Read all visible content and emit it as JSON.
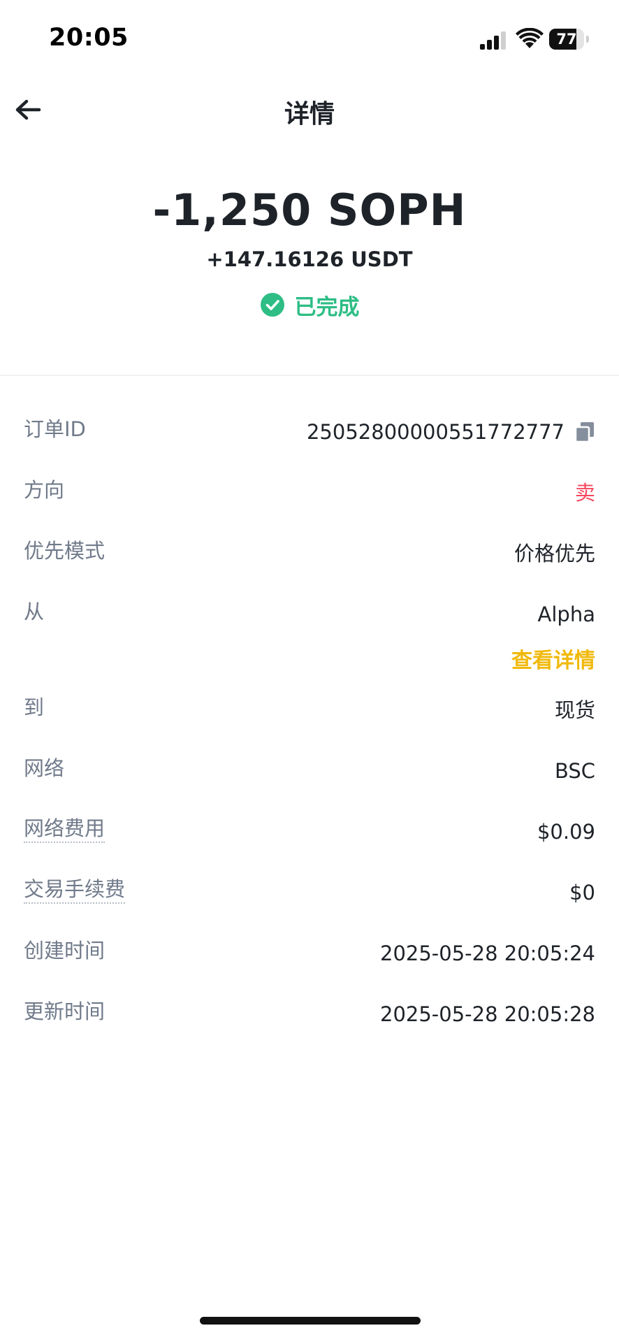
{
  "status_bar": {
    "time": "20:05",
    "battery_level": "77",
    "battery_fraction": 0.77
  },
  "header": {
    "title": "详情"
  },
  "summary": {
    "amount": "-1,250 SOPH",
    "received": "+147.16126 USDT",
    "status": "已完成",
    "status_color": "#2ebd85"
  },
  "details": {
    "order_id": {
      "label": "订单ID",
      "value": "25052800000551772777"
    },
    "direction": {
      "label": "方向",
      "value": "卖",
      "color": "#f6465d"
    },
    "priority_mode": {
      "label": "优先模式",
      "value": "价格优先"
    },
    "from": {
      "label": "从",
      "value": "Alpha"
    },
    "view_details": "查看详情",
    "to": {
      "label": "到",
      "value": "现货"
    },
    "network": {
      "label": "网络",
      "value": "BSC"
    },
    "network_fee": {
      "label": "网络费用",
      "value": "$0.09"
    },
    "trading_fee": {
      "label": "交易手续费",
      "value": "$0"
    },
    "created_time": {
      "label": "创建时间",
      "value": "2025-05-28 20:05:24"
    },
    "updated_time": {
      "label": "更新时间",
      "value": "2025-05-28 20:05:28"
    }
  },
  "colors": {
    "accent_link": "#f0b90b",
    "label_gray": "#707a8a",
    "text_primary": "#1e2329"
  }
}
